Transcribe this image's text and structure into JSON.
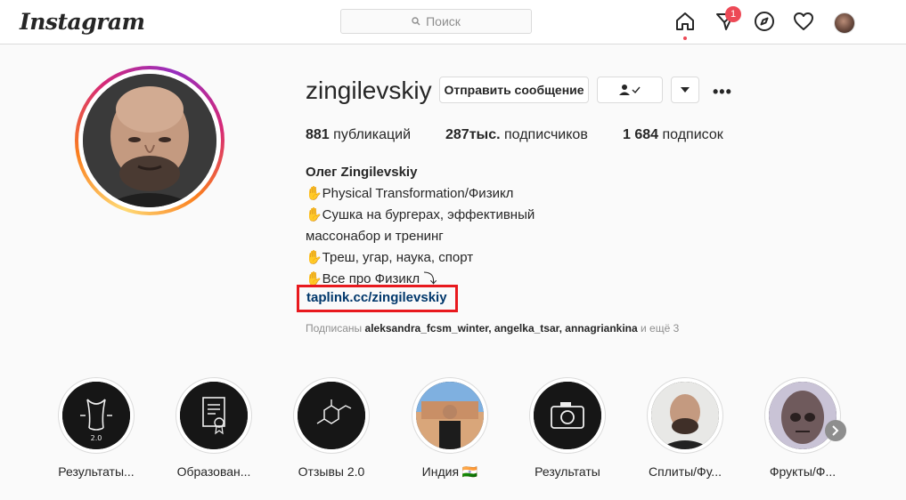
{
  "header": {
    "logo": "Instagram",
    "search_placeholder": "Поиск",
    "notification_count": "1"
  },
  "profile": {
    "username": "zingilevskiy",
    "message_button": "Отправить сообщение",
    "stats": [
      {
        "value": "881",
        "label": "публикаций"
      },
      {
        "value": "287тыс.",
        "label": "подписчиков"
      },
      {
        "value": "1 684",
        "label": "подписок"
      }
    ],
    "full_name": "Олег Zingilevskiy",
    "bio_lines": [
      "✋Physical Transformation/Физикл",
      "✋Сушка на бургерах, эффективный",
      "массонабор и тренинг",
      "✋Треш, угар, наука, спорт",
      "✋Все про Физикл ⤵"
    ],
    "link": "taplink.cc/zingilevskiy",
    "followed_by_prefix": "Подписаны",
    "followed_by_users": "aleksandra_fcsm_winter, angelka_tsar, annagriankina",
    "followed_by_suffix": "и ещё 3"
  },
  "stories": [
    {
      "label": "Результаты..."
    },
    {
      "label": "Образован..."
    },
    {
      "label": "Отзывы 2.0"
    },
    {
      "label": "Индия 🇮🇳"
    },
    {
      "label": "Результаты"
    },
    {
      "label": "Сплиты/Фу..."
    },
    {
      "label": "Фрукты/Ф..."
    }
  ],
  "icons": {
    "search": "search-icon",
    "home": "home-icon",
    "direct": "direct-icon",
    "explore": "compass-icon",
    "activity": "heart-icon",
    "follow_status": "person-check-icon",
    "dropdown": "chevron-down-icon",
    "more": "more-icon"
  },
  "colors": {
    "link": "#00376b",
    "highlight_box": "#e8191e",
    "badge": "#ed4956"
  }
}
